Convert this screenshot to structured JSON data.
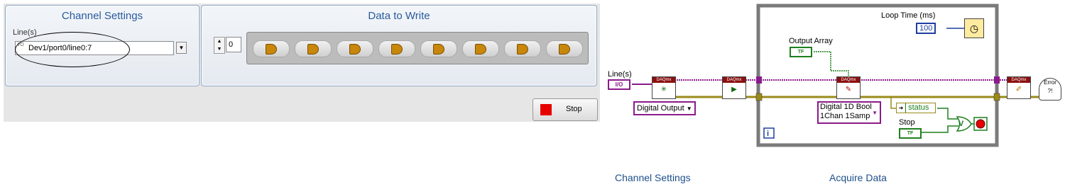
{
  "front_panel": {
    "channel_settings": {
      "title": "Channel Settings",
      "lines_label": "Line(s)",
      "lines_prefix": "I/O",
      "lines_value": "Dev1/port0/line0:7"
    },
    "data_to_write": {
      "title": "Data to Write",
      "index_value": "0",
      "button_count": 8
    },
    "stop_button_label": "Stop"
  },
  "block_diagram": {
    "loop_time_label": "Loop Time (ms)",
    "loop_time_value": "100",
    "output_array_label": "Output Array",
    "tf_label": "TF",
    "lines_control_label": "Line(s)",
    "lines_terminal": "I/O",
    "task_type": "Digital Output",
    "write_mode_line1": "Digital 1D Bool",
    "write_mode_line2": "1Chan 1Samp",
    "status_label": "status",
    "stop_label": "Stop",
    "iteration_label": "i",
    "daqmx_label": "DAQmx",
    "error_label": "Error",
    "or_symbol": "V"
  },
  "captions": {
    "channel_settings": "Channel Settings",
    "acquire_data": "Acquire Data"
  },
  "colors": {
    "group_title": "#2a5b9c",
    "bool_led": "#c8860a",
    "stop_red": "#e60000",
    "task_wire": "#8b1a8b",
    "error_wire": "#9a8a1a",
    "bool_wire": "#1f7f1f",
    "numeric_wire": "#1f3f9f",
    "while_loop": "#7a7a7a"
  }
}
